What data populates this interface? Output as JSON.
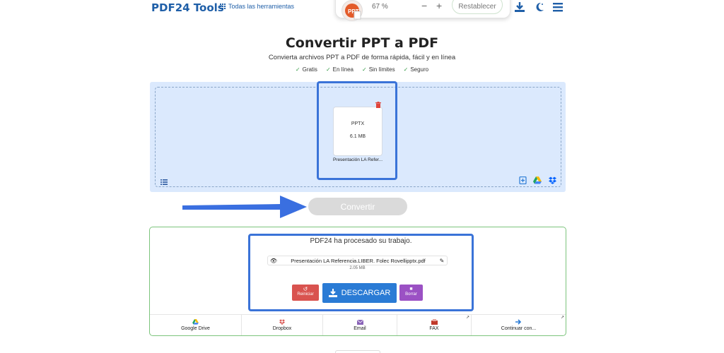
{
  "header": {
    "logo": "PDF24 Tools",
    "all_tools": "Todas las herramientas",
    "zoom": "67 %",
    "zoom_minus": "−",
    "zoom_plus": "+",
    "reset_label": "Restablecer"
  },
  "page": {
    "title": "Convertir PPT a PDF",
    "subtitle": "Convierta archivos PPT a PDF de forma rápida, fácil y en línea",
    "features": [
      "Gratis",
      "En línea",
      "Sin límites",
      "Seguro"
    ],
    "check": "✓"
  },
  "upload": {
    "file_type": "PPTX",
    "file_size": "6.1 MB",
    "file_name": "Presentación LA Refer..."
  },
  "convert_label": "Convertir",
  "result": {
    "message": "PDF24 ha procesado su trabajo.",
    "output_name": "Presentación LA Referencia.LIBER. Folec Rovellipptx.pdf",
    "output_size": "2.05 MB",
    "restart_label": "Reiniciar",
    "download_label": "DESCARGAR",
    "delete_label": "Borrar",
    "services": [
      {
        "label": "Google Drive",
        "icon": "google-drive-icon"
      },
      {
        "label": "Dropbox",
        "icon": "dropbox-icon"
      },
      {
        "label": "Email",
        "icon": "email-icon"
      },
      {
        "label": "FAX",
        "icon": "fax-icon"
      },
      {
        "label": "Continuar con...",
        "icon": "arrow-right-icon"
      }
    ]
  },
  "colors": {
    "brand": "#1f5fa8",
    "highlight": "#3a73d8",
    "download": "#2a7bd5",
    "restart": "#d9534f",
    "delete": "#9b51c4",
    "result_border": "#7cc47c"
  }
}
